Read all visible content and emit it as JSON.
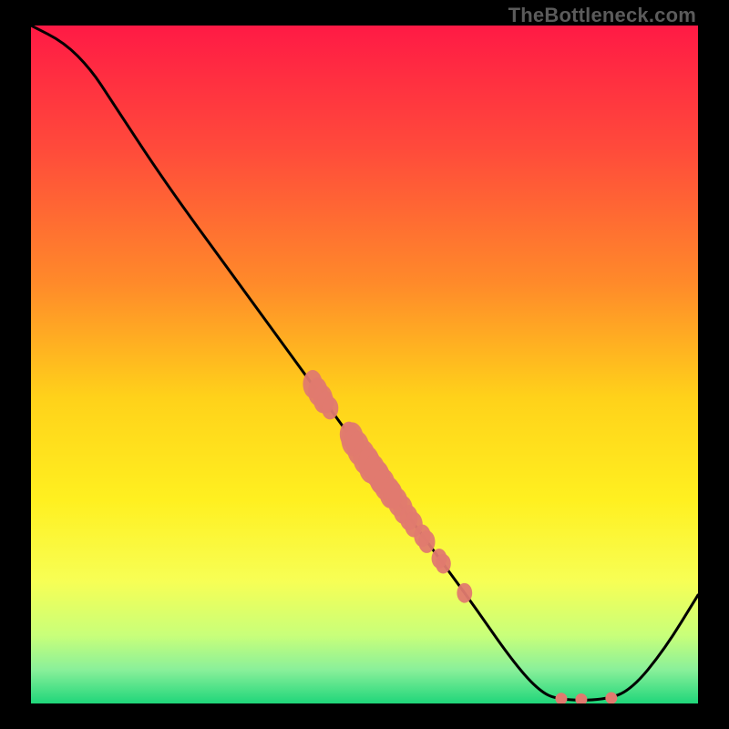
{
  "watermark": "TheBottleneck.com",
  "chart_data": {
    "type": "line",
    "title": "",
    "xlabel": "",
    "ylabel": "",
    "xlim": [
      0,
      100
    ],
    "ylim": [
      0,
      100
    ],
    "gradient_stops": [
      {
        "offset": 0.0,
        "color": "#ff1a45"
      },
      {
        "offset": 0.18,
        "color": "#ff4a3b"
      },
      {
        "offset": 0.38,
        "color": "#ff8a2a"
      },
      {
        "offset": 0.55,
        "color": "#ffd21a"
      },
      {
        "offset": 0.7,
        "color": "#fff020"
      },
      {
        "offset": 0.82,
        "color": "#f7ff55"
      },
      {
        "offset": 0.9,
        "color": "#c8ff7a"
      },
      {
        "offset": 0.95,
        "color": "#8af09a"
      },
      {
        "offset": 1.0,
        "color": "#1fd67a"
      }
    ],
    "curve": [
      {
        "x": 0.0,
        "y": 100.0
      },
      {
        "x": 5.0,
        "y": 97.5
      },
      {
        "x": 9.0,
        "y": 93.5
      },
      {
        "x": 12.0,
        "y": 89.0
      },
      {
        "x": 20.0,
        "y": 77.0
      },
      {
        "x": 30.0,
        "y": 63.5
      },
      {
        "x": 40.0,
        "y": 50.0
      },
      {
        "x": 50.0,
        "y": 36.5
      },
      {
        "x": 60.0,
        "y": 23.0
      },
      {
        "x": 66.0,
        "y": 15.0
      },
      {
        "x": 72.0,
        "y": 6.5
      },
      {
        "x": 76.0,
        "y": 2.0
      },
      {
        "x": 79.0,
        "y": 0.5
      },
      {
        "x": 86.0,
        "y": 0.5
      },
      {
        "x": 90.0,
        "y": 2.0
      },
      {
        "x": 95.0,
        "y": 8.0
      },
      {
        "x": 100.0,
        "y": 16.0
      }
    ],
    "clusters": [
      {
        "cx": 43.0,
        "cy": 46.0,
        "rx": 1.4,
        "ry": 2.0,
        "parts": 3
      },
      {
        "cx": 44.5,
        "cy": 44.0,
        "rx": 1.2,
        "ry": 1.6,
        "parts": 2
      },
      {
        "cx": 48.0,
        "cy": 39.2,
        "rx": 1.3,
        "ry": 1.8,
        "parts": 2
      },
      {
        "cx": 49.5,
        "cy": 37.0,
        "rx": 1.6,
        "ry": 2.4,
        "parts": 4
      },
      {
        "cx": 51.5,
        "cy": 34.4,
        "rx": 1.5,
        "ry": 2.2,
        "parts": 3
      },
      {
        "cx": 53.0,
        "cy": 32.3,
        "rx": 1.5,
        "ry": 2.2,
        "parts": 3
      },
      {
        "cx": 55.0,
        "cy": 29.7,
        "rx": 1.4,
        "ry": 2.0,
        "parts": 3
      },
      {
        "cx": 57.0,
        "cy": 26.9,
        "rx": 1.3,
        "ry": 1.8,
        "parts": 2
      },
      {
        "cx": 59.0,
        "cy": 24.3,
        "rx": 1.2,
        "ry": 1.6,
        "parts": 2
      },
      {
        "cx": 61.5,
        "cy": 21.0,
        "rx": 1.1,
        "ry": 1.4,
        "parts": 2
      },
      {
        "cx": 65.0,
        "cy": 16.3,
        "rx": 1.1,
        "ry": 1.4,
        "parts": 1
      }
    ],
    "bottom_points": [
      {
        "x": 79.5,
        "y": 0.7
      },
      {
        "x": 82.5,
        "y": 0.6
      },
      {
        "x": 87.0,
        "y": 0.8
      }
    ]
  }
}
